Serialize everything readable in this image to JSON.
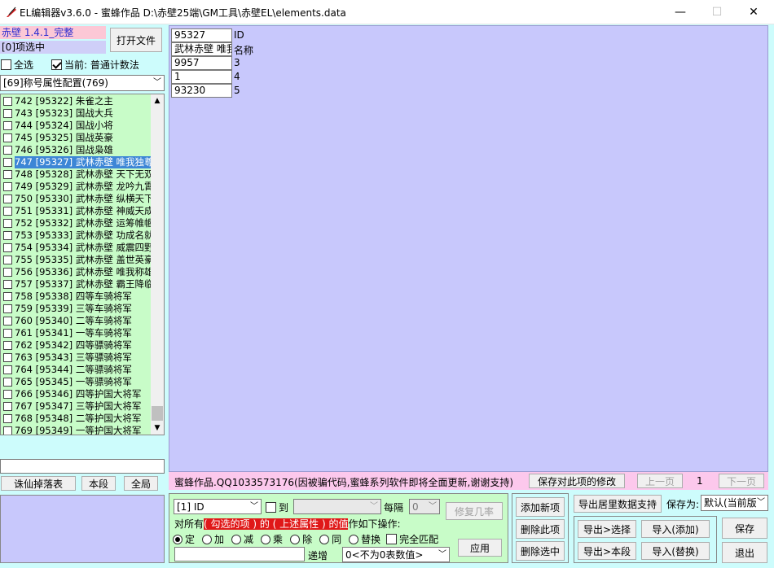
{
  "window": {
    "title": "EL编辑器v3.6.0  -  蜜蜂作品  D:\\赤壁25端\\GM工具\\赤壁EL\\elements.data",
    "minimize": "—",
    "maximize": "☐",
    "close": "✕"
  },
  "left": {
    "version_label": "赤壁 1.4.1_完整",
    "selected_count": "[0]项选中",
    "open_file_button": "打开文件",
    "select_all_label": "全选",
    "current_label": "当前: 普通计数法",
    "category_select": "[69]称号属性配置(769)",
    "list_items": [
      {
        "idx": "742",
        "id": "[95322]",
        "name": "朱雀之主",
        "selected": false
      },
      {
        "idx": "743",
        "id": "[95323]",
        "name": "国战大兵",
        "selected": false
      },
      {
        "idx": "744",
        "id": "[95324]",
        "name": "国战小将",
        "selected": false
      },
      {
        "idx": "745",
        "id": "[95325]",
        "name": "国战英豪",
        "selected": false
      },
      {
        "idx": "746",
        "id": "[95326]",
        "name": "国战枭雄",
        "selected": false
      },
      {
        "idx": "747",
        "id": "[95327]",
        "name": "武林赤壁 唯我独尊",
        "selected": true
      },
      {
        "idx": "748",
        "id": "[95328]",
        "name": "武林赤壁 天下无双",
        "selected": false
      },
      {
        "idx": "749",
        "id": "[95329]",
        "name": "武林赤壁 龙吟九霄",
        "selected": false
      },
      {
        "idx": "750",
        "id": "[95330]",
        "name": "武林赤壁 纵横天下",
        "selected": false
      },
      {
        "idx": "751",
        "id": "[95331]",
        "name": "武林赤壁 神威天成",
        "selected": false
      },
      {
        "idx": "752",
        "id": "[95332]",
        "name": "武林赤壁 运筹帷幄",
        "selected": false
      },
      {
        "idx": "753",
        "id": "[95333]",
        "name": "武林赤壁 功成名就",
        "selected": false
      },
      {
        "idx": "754",
        "id": "[95334]",
        "name": "武林赤壁 威震四野",
        "selected": false
      },
      {
        "idx": "755",
        "id": "[95335]",
        "name": "武林赤壁 盖世英豪",
        "selected": false
      },
      {
        "idx": "756",
        "id": "[95336]",
        "name": "武林赤壁 唯我称雄",
        "selected": false
      },
      {
        "idx": "757",
        "id": "[95337]",
        "name": "武林赤壁 霸王降临",
        "selected": false
      },
      {
        "idx": "758",
        "id": "[95338]",
        "name": "四等车骑将军",
        "selected": false
      },
      {
        "idx": "759",
        "id": "[95339]",
        "name": "三等车骑将军",
        "selected": false
      },
      {
        "idx": "760",
        "id": "[95340]",
        "name": "二等车骑将军",
        "selected": false
      },
      {
        "idx": "761",
        "id": "[95341]",
        "name": "一等车骑将军",
        "selected": false
      },
      {
        "idx": "762",
        "id": "[95342]",
        "name": "四等骠骑将军",
        "selected": false
      },
      {
        "idx": "763",
        "id": "[95343]",
        "name": "三等骠骑将军",
        "selected": false
      },
      {
        "idx": "764",
        "id": "[95344]",
        "name": "二等骠骑将军",
        "selected": false
      },
      {
        "idx": "765",
        "id": "[95345]",
        "name": "一等骠骑将军",
        "selected": false
      },
      {
        "idx": "766",
        "id": "[95346]",
        "name": "四等护国大将军",
        "selected": false
      },
      {
        "idx": "767",
        "id": "[95347]",
        "name": "三等护国大将军",
        "selected": false
      },
      {
        "idx": "768",
        "id": "[95348]",
        "name": "二等护国大将军",
        "selected": false
      },
      {
        "idx": "769",
        "id": "[95349]",
        "name": "一等护国大将军",
        "selected": false
      }
    ],
    "search_value": "",
    "btn_drop_table": "诛仙掉落表",
    "btn_this_section": "本段",
    "btn_global": "全局"
  },
  "fields": [
    {
      "value": "95327",
      "label": "ID"
    },
    {
      "value": "武林赤壁 唯我",
      "label": "名称"
    },
    {
      "value": "9957",
      "label": "3"
    },
    {
      "value": "1",
      "label": "4"
    },
    {
      "value": "93230",
      "label": "5"
    }
  ],
  "status": {
    "text": "蜜蜂作品.QQ1033573176(因被骗代码,蜜蜂系列软件即将全面更新,谢谢支持)",
    "save_changes": "保存对此项的修改",
    "prev_page": "上一页",
    "page_num": "1",
    "next_page": "下一页"
  },
  "batch": {
    "field_select": "[1] ID",
    "to_label": "到",
    "to_select": "",
    "interval_label": "每隔",
    "interval_value": "0",
    "repair_button": "修复几率",
    "desc_prefix": "对所有",
    "desc_red1": "( 勾选的项 ) 的 ( 上述属性 ) 的值",
    "desc_suffix": "作如下操作:",
    "ops": [
      "定",
      "加",
      "减",
      "乘",
      "除",
      "同",
      "替换"
    ],
    "full_match": "完全匹配",
    "apply": "应用",
    "increment_label": "递增",
    "increment_select": "0<不为0表数值>"
  },
  "actions": {
    "add_new": "添加新项",
    "delete_this": "删除此项",
    "delete_selected": "删除选中",
    "export_support": "导出居里数据支持",
    "save_as_label": "保存为:",
    "save_as_select": "默认(当前版",
    "export_select": "导出>选择",
    "import_add": "导入(添加)",
    "export_section": "导出>本段",
    "import_replace": "导入(替换)",
    "save": "保存",
    "exit": "退出"
  }
}
